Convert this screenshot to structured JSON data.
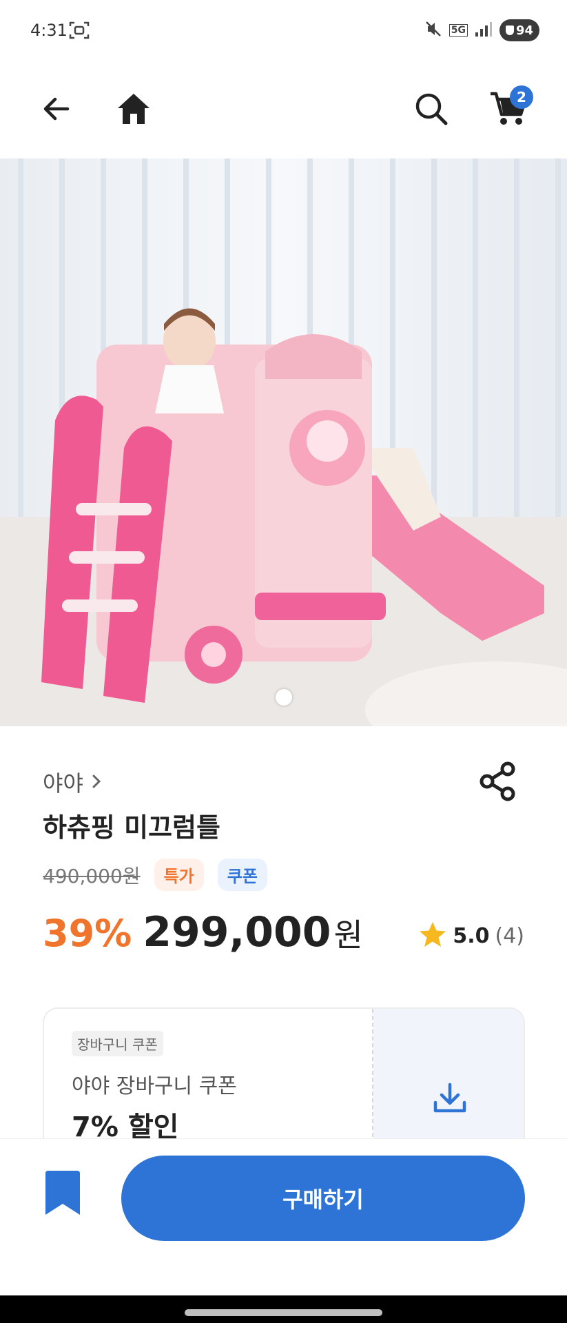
{
  "status_bar": {
    "time": "4:31",
    "network": "5G",
    "battery": "94"
  },
  "header": {
    "cart_count": "2"
  },
  "product": {
    "brand": "야야",
    "title": "하츄핑 미끄럼틀",
    "original_price": "490,000원",
    "tags": {
      "special": "특가",
      "coupon": "쿠폰"
    },
    "discount": "39%",
    "price": "299,000",
    "currency": "원",
    "rating": "5.0",
    "review_count": "(4)"
  },
  "coupon": {
    "chip": "장바구니 쿠폰",
    "name": "야야 장바구니 쿠폰",
    "amount": "7% 할인"
  },
  "bottom": {
    "buy_label": "구매하기"
  },
  "colors": {
    "accent": "#2d74d6",
    "discount": "#f0742b",
    "star": "#f5b91f"
  },
  "icons": [
    "back-arrow-icon",
    "home-icon",
    "search-icon",
    "cart-icon",
    "share-icon",
    "star-icon",
    "download-icon",
    "bookmark-icon",
    "chevron-right-icon"
  ]
}
